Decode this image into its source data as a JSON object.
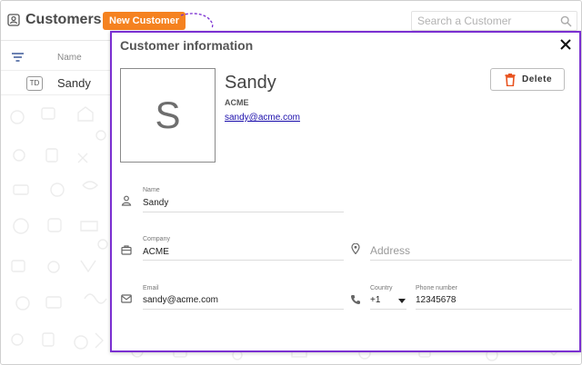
{
  "header": {
    "title": "Customers",
    "new_button": "New Customer",
    "search_placeholder": "Search a Customer"
  },
  "list": {
    "column_name": "Name",
    "rows": [
      {
        "initials": "TD",
        "name": "Sandy"
      }
    ]
  },
  "modal": {
    "title": "Customer information",
    "photo_initial": "S",
    "customer_name": "Sandy",
    "company": "ACME",
    "email": "sandy@acme.com",
    "delete_label": "Delete",
    "fields": {
      "name": {
        "label": "Name",
        "value": "Sandy"
      },
      "company": {
        "label": "Company",
        "value": "ACME"
      },
      "address": {
        "placeholder": "Address"
      },
      "email": {
        "label": "Email",
        "value": "sandy@acme.com"
      },
      "country": {
        "label": "Country",
        "value": "+1"
      },
      "phone": {
        "label": "Phone number",
        "value": "12345678"
      }
    }
  },
  "colors": {
    "accent_orange": "#f58220",
    "modal_border_purple": "#7a2fd1",
    "delete_icon_orange": "#e8521e"
  },
  "icons": [
    "contact-card-icon",
    "search-icon",
    "filter-icon",
    "close-icon",
    "trash-icon",
    "person-icon",
    "briefcase-icon",
    "location-pin-icon",
    "mail-icon",
    "phone-icon",
    "caret-down-icon"
  ]
}
